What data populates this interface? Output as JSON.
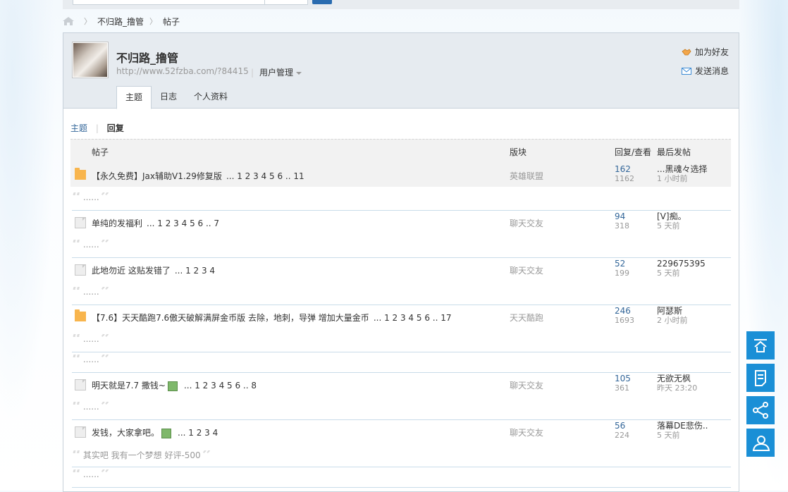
{
  "breadcrumb": {
    "items": [
      "不归路_撸管",
      "帖子"
    ]
  },
  "profile": {
    "name": "不归路_撸管",
    "url": "http://www.52fzba.com/?84415",
    "manage_label": "用户管理",
    "add_friend": "加为好友",
    "send_message": "发送消息"
  },
  "tabs": [
    "主题",
    "日志",
    "个人资料"
  ],
  "subnav": {
    "topics": "主题",
    "replies": "回复"
  },
  "table_headers": {
    "post": "帖子",
    "forum": "版块",
    "stats": "回复/查看",
    "last": "最后发帖"
  },
  "threads": [
    {
      "title": "【永久免费】Jax辅助V1.29修复版",
      "pages": "... 1 2 3 4 5 6 .. 11",
      "forum": "英雄联盟",
      "replies": "162",
      "views": "1162",
      "last_user": "...黑魂々选择",
      "last_time": "1 小时前",
      "quote": "......",
      "hot": true
    },
    {
      "title": "单纯的发福利",
      "pages": "... 1 2 3 4 5 6 .. 7",
      "forum": "聊天交友",
      "replies": "94",
      "views": "318",
      "last_user": "[V]痴。",
      "last_time": "5 天前",
      "quote": "......",
      "hot": false
    },
    {
      "title": "此地勿近 这贴发错了",
      "pages": "... 1 2 3 4",
      "forum": "聊天交友",
      "replies": "52",
      "views": "199",
      "last_user": "229675395",
      "last_time": "5 天前",
      "quote": "......",
      "hot": false
    },
    {
      "title": "【7.6】天天酷跑7.6傲天破解满屏金币版 去除，地刺，导弹 增加大量金币",
      "pages": "... 1 2 3 4 5 6 .. 17",
      "forum": "天天酷跑",
      "replies": "246",
      "views": "1693",
      "last_user": "阿瑟斯",
      "last_time": "2 小时前",
      "quote": "......",
      "extra_quote": "......",
      "hot": true
    },
    {
      "title": "明天就是7.7 撒钱~",
      "pages": "... 1 2 3 4 5 6 .. 8",
      "forum": "聊天交友",
      "replies": "105",
      "views": "361",
      "last_user": "无欲无枫",
      "last_time": "昨天 23:20",
      "quote": "......",
      "hot": false,
      "img": true
    },
    {
      "title": "发钱，大家拿吧。",
      "pages": "... 1 2 3 4",
      "forum": "聊天交友",
      "replies": "56",
      "views": "224",
      "last_user": "落幕DE悲伤..",
      "last_time": "5 天前",
      "quote": "其实吧 我有一个梦想 好评-500",
      "extra_quote": "......",
      "hot": false,
      "img": true
    }
  ],
  "side_buttons": [
    "back-to-top-icon",
    "document-icon",
    "share-icon",
    "user-icon"
  ],
  "colors": {
    "accent": "#1a8fd6",
    "link": "#336699",
    "folder": "#f8b54d"
  }
}
